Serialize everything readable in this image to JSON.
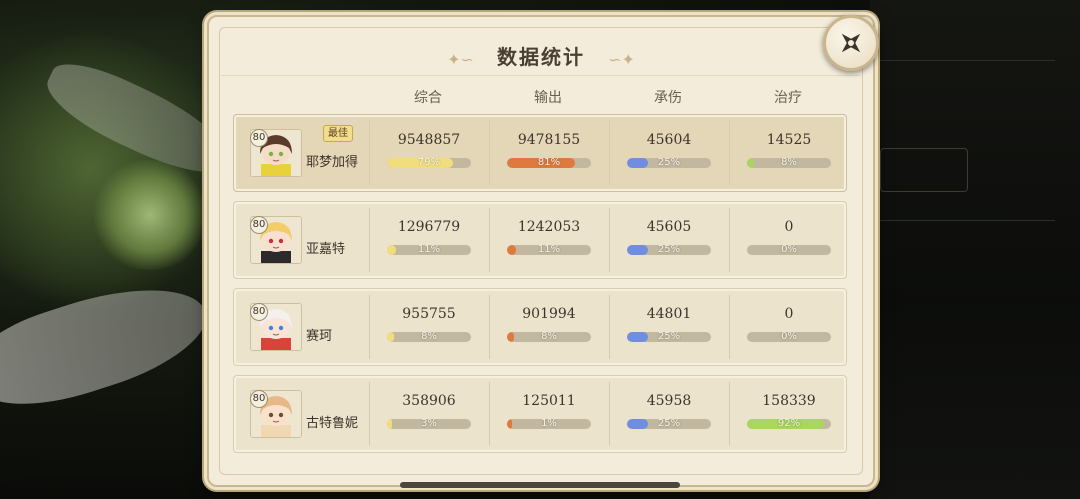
{
  "header": {
    "title": "数据统计"
  },
  "columns": [
    "综合",
    "输出",
    "承伤",
    "治疗"
  ],
  "best_label": "最佳",
  "colors": {
    "综合": "#f0de7c",
    "输出": "#de7a3e",
    "承伤": "#6f8ee0",
    "治疗": "#a8d660"
  },
  "rows": [
    {
      "level": "80",
      "name": "耶梦加得",
      "best": true,
      "stats": [
        {
          "value": "9548857",
          "pct": "79%",
          "fraction": 0.79
        },
        {
          "value": "9478155",
          "pct": "81%",
          "fraction": 0.81
        },
        {
          "value": "45604",
          "pct": "25%",
          "fraction": 0.25
        },
        {
          "value": "14525",
          "pct": "8%",
          "fraction": 0.08
        }
      ]
    },
    {
      "level": "80",
      "name": "亚嘉特",
      "best": false,
      "stats": [
        {
          "value": "1296779",
          "pct": "11%",
          "fraction": 0.11
        },
        {
          "value": "1242053",
          "pct": "11%",
          "fraction": 0.11
        },
        {
          "value": "45605",
          "pct": "25%",
          "fraction": 0.25
        },
        {
          "value": "0",
          "pct": "0%",
          "fraction": 0
        }
      ]
    },
    {
      "level": "80",
      "name": "赛珂",
      "best": false,
      "stats": [
        {
          "value": "955755",
          "pct": "8%",
          "fraction": 0.08
        },
        {
          "value": "901994",
          "pct": "8%",
          "fraction": 0.08
        },
        {
          "value": "44801",
          "pct": "25%",
          "fraction": 0.25
        },
        {
          "value": "0",
          "pct": "0%",
          "fraction": 0
        }
      ]
    },
    {
      "level": "80",
      "name": "古特鲁妮",
      "best": false,
      "stats": [
        {
          "value": "358906",
          "pct": "3%",
          "fraction": 0.03
        },
        {
          "value": "125011",
          "pct": "1%",
          "fraction": 0.01
        },
        {
          "value": "45958",
          "pct": "25%",
          "fraction": 0.25
        },
        {
          "value": "158339",
          "pct": "92%",
          "fraction": 0.92
        }
      ]
    }
  ]
}
